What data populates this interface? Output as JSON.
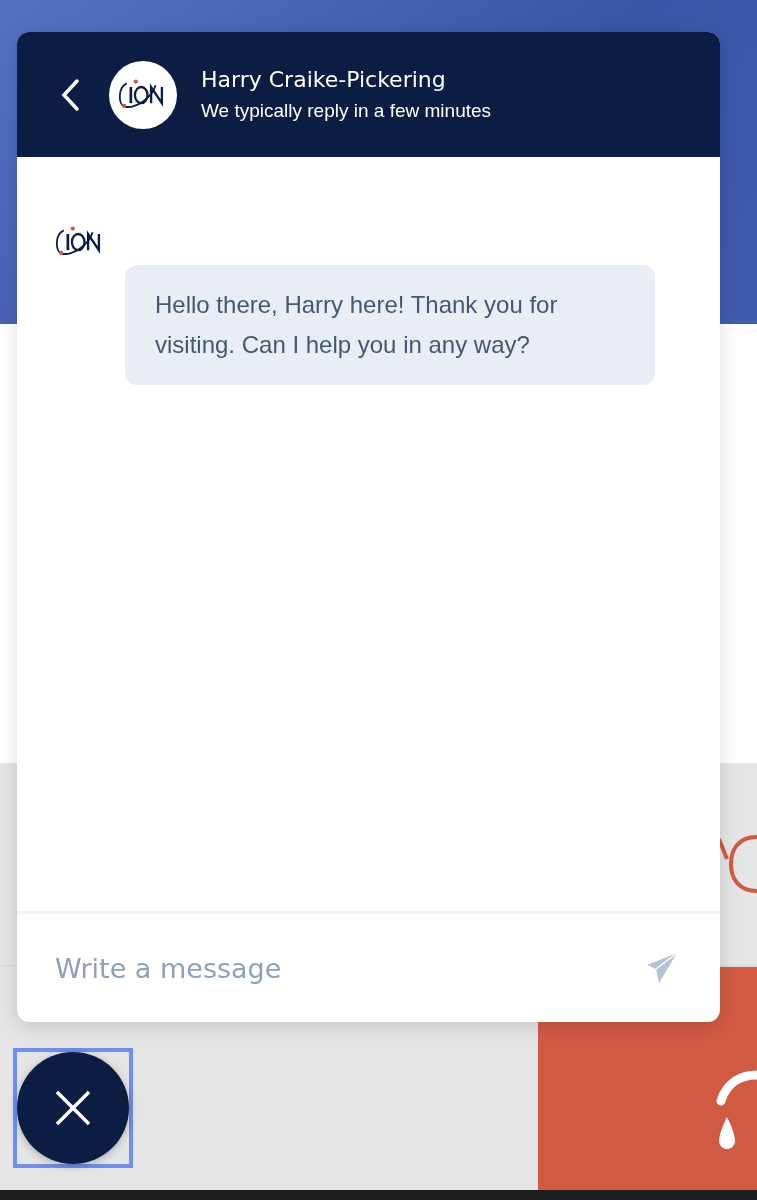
{
  "header": {
    "name": "Harry Craike-Pickering",
    "status": "We typically reply in a few minutes"
  },
  "messages": [
    {
      "kind": "incoming",
      "text": "Hello there, Harry here! Thank you for visiting. Can I help you in any way?"
    }
  ],
  "composer": {
    "placeholder": "Write a message"
  },
  "launcher": {
    "focused": true
  }
}
